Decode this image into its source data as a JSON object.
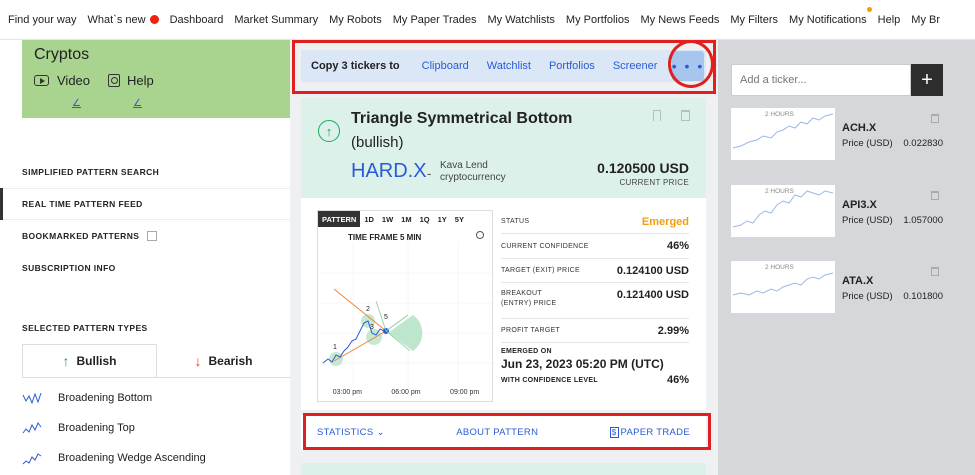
{
  "nav": {
    "items": [
      "Find your way",
      "What`s new",
      "Dashboard",
      "Market Summary",
      "My Robots",
      "My Paper Trades",
      "My Watchlists",
      "My Portfolios",
      "My News Feeds",
      "My Filters",
      "My Notifications",
      "Help",
      "My Br"
    ]
  },
  "sidebar": {
    "card_title": "Cryptos",
    "video_label": "Video",
    "help_label": "Help",
    "menu": [
      "SIMPLIFIED PATTERN SEARCH",
      "REAL TIME PATTERN FEED",
      "BOOKMARKED PATTERNS",
      "SUBSCRIPTION INFO"
    ],
    "section_title": "SELECTED PATTERN TYPES",
    "bullish_label": "Bullish",
    "bearish_label": "Bearish",
    "pattern_types": [
      "Broadening Bottom",
      "Broadening Top",
      "Broadening Wedge Ascending"
    ]
  },
  "copybar": {
    "label": "Copy 3 tickers to",
    "links": [
      "Clipboard",
      "Watchlist",
      "Portfolios",
      "Screener"
    ],
    "more": "• • •"
  },
  "pattern": {
    "title": "Triangle Symmetrical Bottom",
    "subtitle": "(bullish)",
    "ticker": "HARD.X",
    "dash": "-",
    "name": "Kava Lend cryptocurrency",
    "price": "0.120500 USD",
    "price_label": "CURRENT PRICE",
    "timeframes": [
      "PATTERN",
      "1D",
      "1W",
      "1M",
      "1Q",
      "1Y",
      "5Y"
    ],
    "timeframe_label": "TIME FRAME 5 MIN",
    "x_ticks": [
      "03:00 pm",
      "06:00 pm",
      "09:00 pm"
    ],
    "chart_markers": [
      "1",
      "2",
      "3",
      "5"
    ],
    "stats": [
      {
        "label": "STATUS",
        "value": "Emerged"
      },
      {
        "label": "CURRENT CONFIDENCE",
        "value": "46%"
      },
      {
        "label": "TARGET (EXIT) PRICE",
        "value": "0.124100 USD"
      },
      {
        "label": "BREAKOUT (ENTRY) PRICE",
        "value": "0.121400 USD"
      },
      {
        "label": "PROFIT TARGET",
        "value": "2.99%"
      }
    ],
    "emerged_on_label": "EMERGED ON",
    "emerged_date": "Jun 23, 2023 05:20 PM (UTC)",
    "confidence_label": "WITH CONFIDENCE LEVEL",
    "confidence_value": "46%",
    "links": {
      "statistics": "STATISTICS",
      "about": "ABOUT PATTERN",
      "paper_trade": "PAPER TRADE"
    }
  },
  "watchlist": {
    "input_placeholder": "Add a ticker...",
    "add_label": "+",
    "items": [
      {
        "spark_label": "2 HOURS",
        "symbol": "ACH.X",
        "price_label": "Price (USD)",
        "price": "0.022830"
      },
      {
        "spark_label": "2 HOURS",
        "symbol": "API3.X",
        "price_label": "Price (USD)",
        "price": "1.057000"
      },
      {
        "spark_label": "2 HOURS",
        "symbol": "ATA.X",
        "price_label": "Price (USD)",
        "price": "0.101800"
      }
    ]
  },
  "colors": {
    "accent": "#2a5bd7",
    "bullish": "#1aa85a",
    "bearish": "#e23a2e",
    "emerged": "#f39c12",
    "highlight": "#e02020"
  }
}
